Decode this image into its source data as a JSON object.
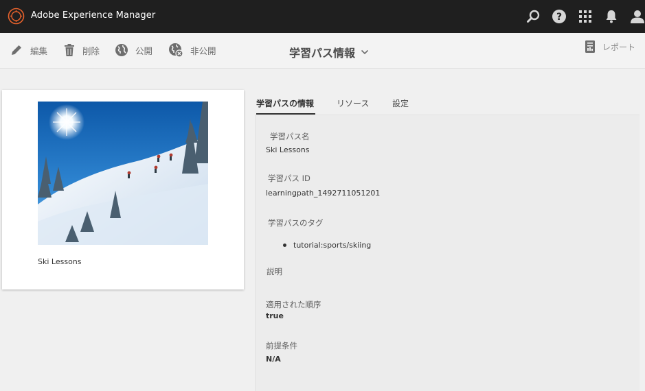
{
  "app": {
    "title": "Adobe Experience Manager"
  },
  "topbar_icons": [
    "search-icon",
    "help-icon",
    "apps-grid-icon",
    "bell-icon",
    "user-icon"
  ],
  "actions": {
    "edit": "編集",
    "delete": "削除",
    "publish": "公開",
    "unpublish": "非公開",
    "report": "レポート"
  },
  "page_title": "学習パス情報",
  "card": {
    "title": "Ski Lessons"
  },
  "tabs": [
    "学習パスの情報",
    "リソース",
    "設定"
  ],
  "fields": {
    "name": {
      "label": "学習パス名",
      "value": "Ski Lessons"
    },
    "id": {
      "label": "学習パス ID",
      "value": "learningpath_1492711051201"
    },
    "tags": {
      "label": "学習パスのタグ",
      "items": [
        "tutorial:sports/skiing"
      ]
    },
    "description": {
      "label": "説明",
      "value": ""
    },
    "order": {
      "label": "適用された順序",
      "value": "true"
    },
    "prereq": {
      "label": "前提条件",
      "value": "N/A"
    }
  },
  "colors": {
    "topbar": "#1f1f1f",
    "logo_accent": "#e8622c",
    "panel": "#ececec"
  }
}
